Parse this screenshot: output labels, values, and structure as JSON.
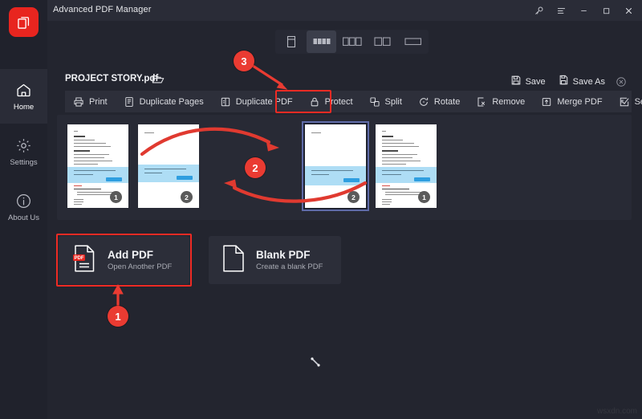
{
  "app": {
    "title": "Advanced PDF Manager",
    "logo_icon": "pdf-pages-logo-icon",
    "accent_color": "#e8251f",
    "annotation_color": "#ea3b32",
    "selection_color": "#5f6ba8",
    "watermark": "wsxdn.com"
  },
  "titlebar": {
    "buttons": [
      {
        "name": "key-icon",
        "label": ""
      },
      {
        "name": "menu-icon",
        "label": ""
      },
      {
        "name": "minimize-icon",
        "label": ""
      },
      {
        "name": "maximize-icon",
        "label": ""
      },
      {
        "name": "close-icon",
        "label": ""
      }
    ]
  },
  "sidebar": {
    "items": [
      {
        "label": "Home",
        "icon": "home-icon",
        "active": true
      },
      {
        "label": "Settings",
        "icon": "gear-icon",
        "active": false
      },
      {
        "label": "About Us",
        "icon": "info-icon",
        "active": false
      }
    ]
  },
  "view_modes": [
    {
      "name": "single-page-view",
      "icon": "single-page-icon",
      "active": false
    },
    {
      "name": "four-up-view",
      "icon": "grid-four-icon",
      "active": true
    },
    {
      "name": "three-up-view",
      "icon": "grid-three-icon",
      "active": false
    },
    {
      "name": "two-up-view",
      "icon": "grid-two-icon",
      "active": false
    },
    {
      "name": "one-up-view",
      "icon": "grid-one-icon",
      "active": false
    }
  ],
  "document": {
    "file_name": "PROJECT STORY.pdf",
    "open_icon": "open-folder-icon",
    "save_label": "Save",
    "save_as_label": "Save As",
    "close_icon": "close-document-icon"
  },
  "toolbar": {
    "items": [
      {
        "label": "Print",
        "icon": "printer-icon",
        "highlighted": false
      },
      {
        "label": "Duplicate Pages",
        "icon": "duplicate-pages-icon",
        "highlighted": false
      },
      {
        "label": "Duplicate PDF",
        "icon": "duplicate-pdf-icon",
        "highlighted": false
      },
      {
        "label": "Protect",
        "icon": "lock-icon",
        "highlighted": true
      },
      {
        "label": "Split",
        "icon": "split-icon",
        "highlighted": false
      },
      {
        "label": "Rotate",
        "icon": "rotate-icon",
        "highlighted": false
      },
      {
        "label": "Remove",
        "icon": "remove-icon",
        "highlighted": false
      },
      {
        "label": "Merge PDF",
        "icon": "merge-pdf-icon",
        "highlighted": false
      },
      {
        "label": "Select All",
        "icon": "checkbox-icon",
        "highlighted": false
      }
    ],
    "overflow_icon": "chevron-down-icon"
  },
  "pages": [
    {
      "number": "1",
      "selected": false,
      "dense": true
    },
    {
      "number": "2",
      "selected": false,
      "dense": false
    },
    {
      "number": "2",
      "selected": true,
      "dense": false
    },
    {
      "number": "1",
      "selected": false,
      "dense": true
    }
  ],
  "cards": [
    {
      "title": "Add PDF",
      "subtitle": "Open Another PDF",
      "icon": "pdf-file-icon",
      "highlighted": true
    },
    {
      "title": "Blank PDF",
      "subtitle": "Create a blank PDF",
      "icon": "blank-file-icon",
      "highlighted": false
    }
  ],
  "annotations": {
    "markers": [
      {
        "label": "1",
        "points_to": "Add PDF"
      },
      {
        "label": "2",
        "points_to": "page thumbnails reorder"
      },
      {
        "label": "3",
        "points_to": "Protect"
      }
    ]
  }
}
